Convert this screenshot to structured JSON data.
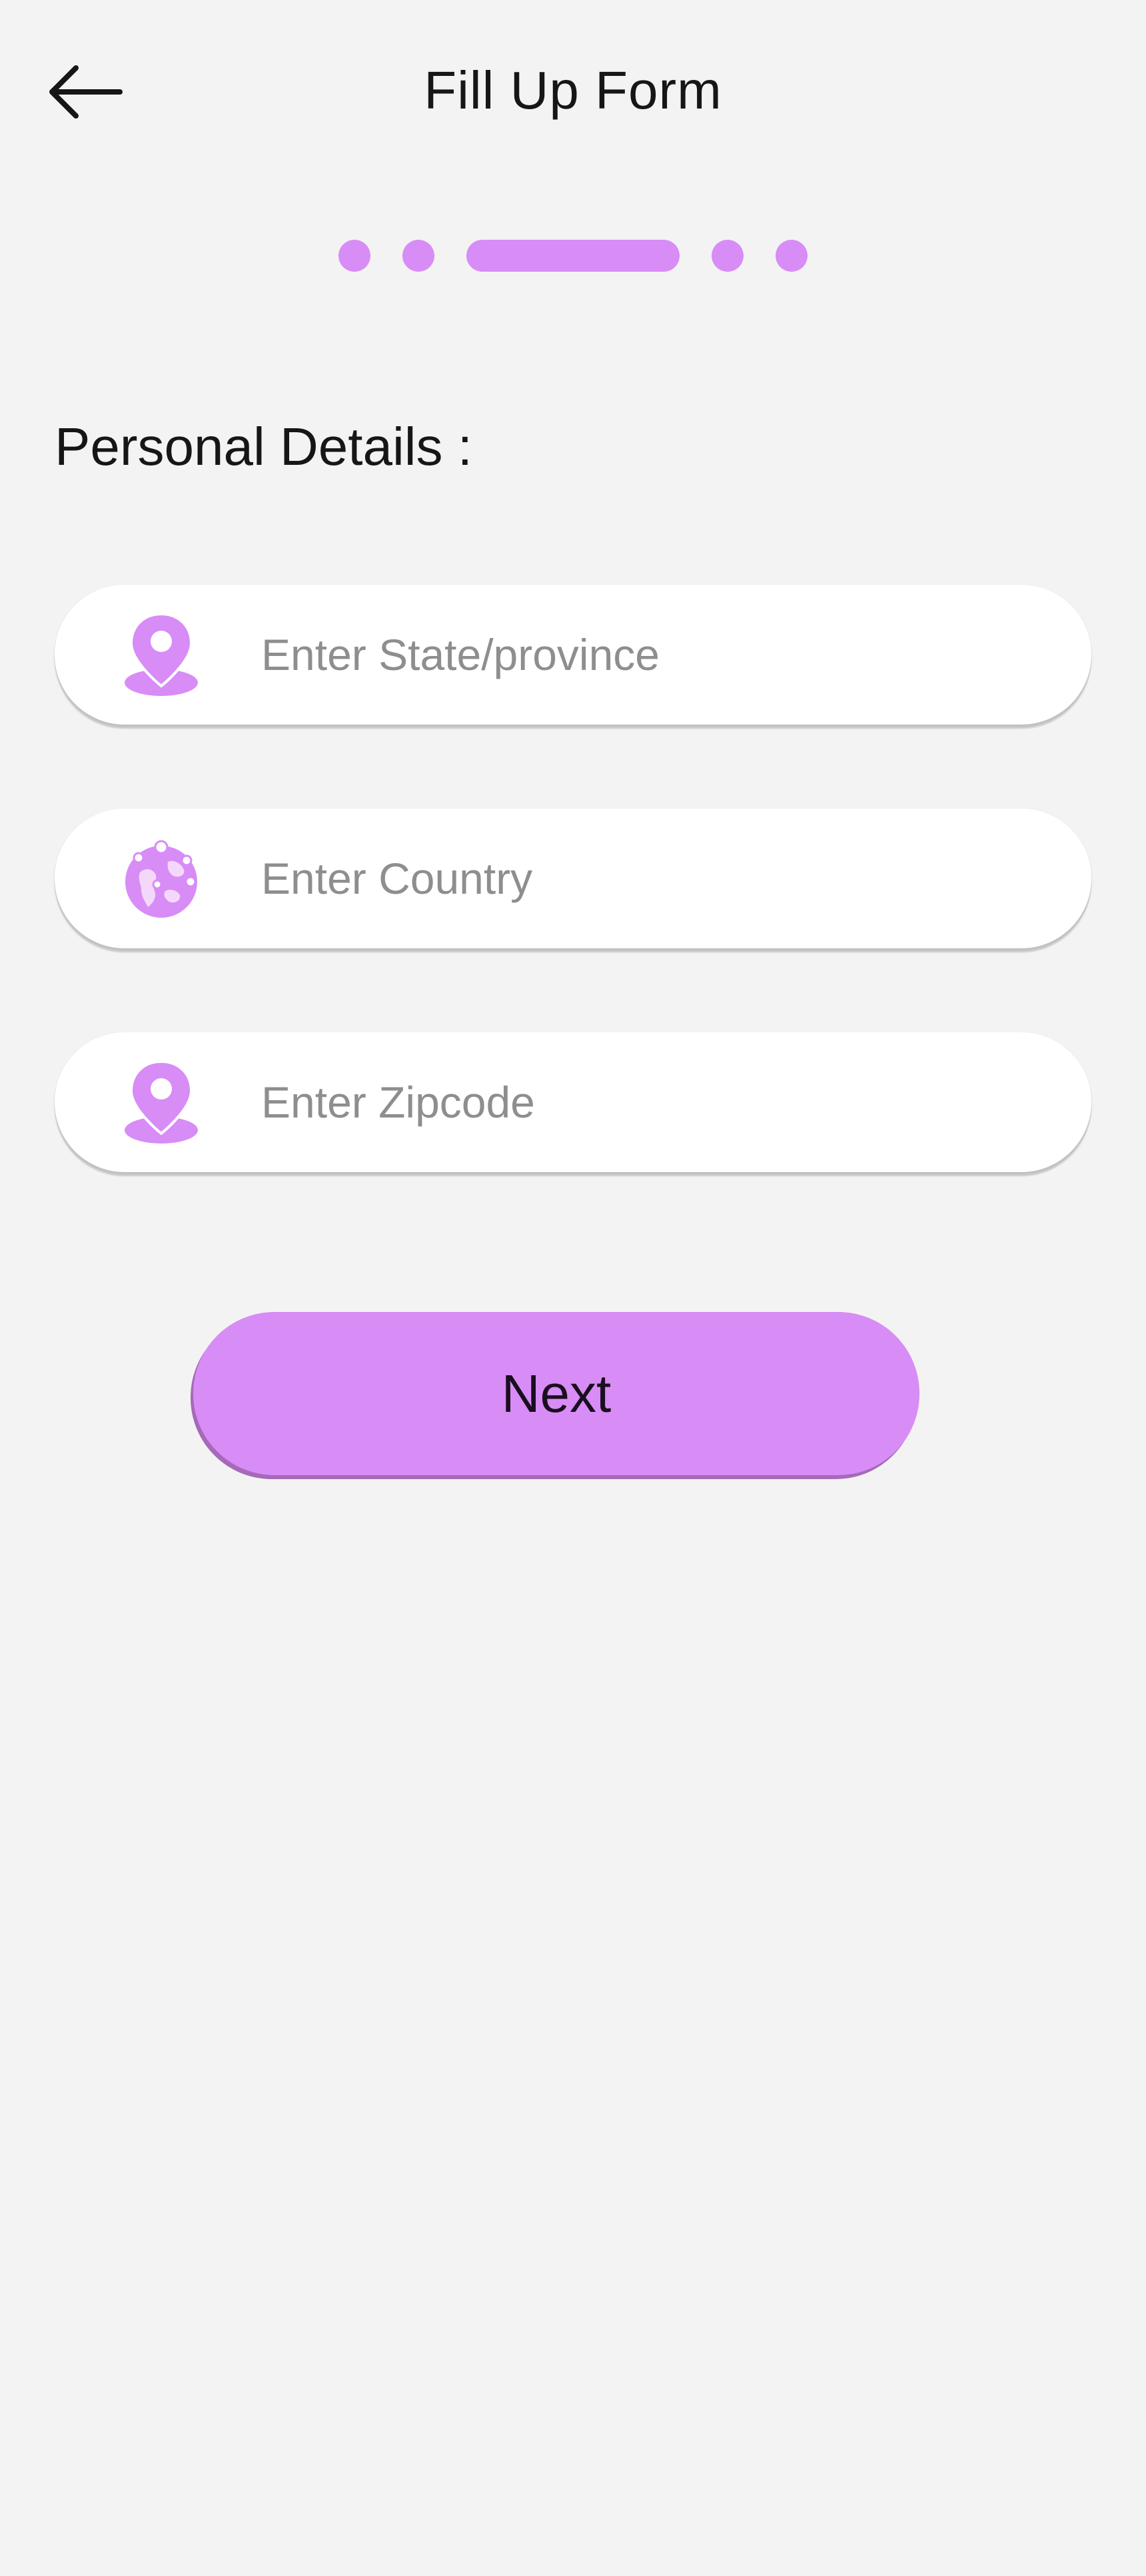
{
  "header": {
    "title": "Fill Up Form",
    "back_icon": "arrow-left-icon"
  },
  "stepper": {
    "total_steps": 5,
    "current_step": 3,
    "color": "#d88cf5"
  },
  "section": {
    "title": "Personal Details :"
  },
  "form": {
    "state": {
      "placeholder": "Enter State/province",
      "value": "",
      "icon": "location-pin-icon"
    },
    "country": {
      "placeholder": "Enter Country",
      "value": "",
      "icon": "globe-icon"
    },
    "zipcode": {
      "placeholder": "Enter Zipcode",
      "value": "",
      "icon": "location-pin-icon"
    }
  },
  "actions": {
    "next_label": "Next"
  },
  "colors": {
    "accent": "#d88cf5",
    "background": "#f3f3f3",
    "field_background": "#ffffff",
    "text": "#161616",
    "placeholder": "#8e8e8e"
  }
}
